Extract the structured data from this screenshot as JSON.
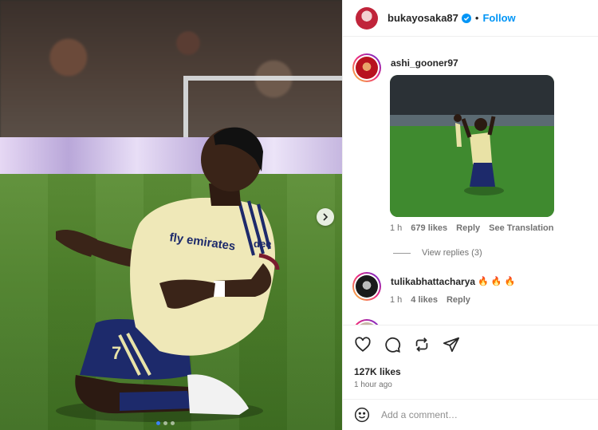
{
  "post": {
    "author": "bukayosaka87",
    "separator": "•",
    "follow_label": "Follow",
    "media_jersey_text": "fly emirates",
    "media_sponsor_text": "dee",
    "media_number": "7",
    "carousel_count": 3,
    "carousel_active": 0
  },
  "comments": [
    {
      "username": "ashi_gooner97",
      "time": "1 h",
      "likes": "679 likes",
      "reply": "Reply",
      "translate": "See Translation",
      "view_replies": "View replies (3)"
    },
    {
      "username": "tulikabhattacharya",
      "emoji": "🔥 🔥 🔥",
      "time": "1 h",
      "likes": "4 likes",
      "reply": "Reply"
    }
  ],
  "footer": {
    "likes": "127K likes",
    "time_ago": "1 hour ago",
    "add_comment_placeholder": "Add a comment…"
  },
  "colors": {
    "accent": "#0095f6",
    "verified": "#0095f6",
    "muted": "#737373",
    "carousel_active_dot": "#3b82f6"
  },
  "icons": [
    "verified-icon",
    "chevron-right-icon",
    "heart-icon",
    "comment-icon",
    "repost-icon",
    "share-icon",
    "emoji-icon"
  ]
}
